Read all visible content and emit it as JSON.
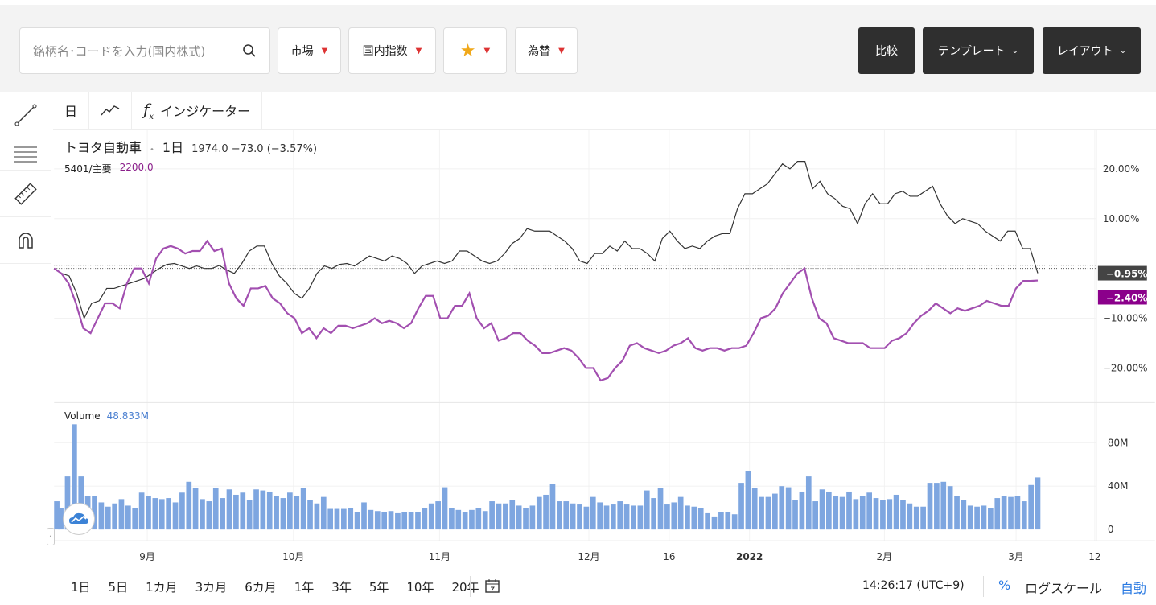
{
  "header": {
    "search_placeholder": "銘柄名･コードを入力(国内株式)",
    "dropdowns": [
      {
        "label": "市場"
      },
      {
        "label": "国内指数"
      },
      {
        "label": "★"
      },
      {
        "label": "為替"
      }
    ],
    "compare_label": "比較",
    "template_label": "テンプレート",
    "layout_label": "レイアウト"
  },
  "chart_toolbar": {
    "interval": "日",
    "indicator_label": "インジケーター"
  },
  "legend": {
    "symbol": "トヨタ自動車",
    "interval": "1日",
    "quote": "1974.0 −73.0 (−3.57%)",
    "compare_symbol": "5401/主要",
    "compare_value": "2200.0"
  },
  "volume_legend": {
    "label": "Volume",
    "value": "48.833M"
  },
  "bottom": {
    "ranges": [
      "1日",
      "5日",
      "1カ月",
      "3カ月",
      "6カ月",
      "1年",
      "3年",
      "5年",
      "10年",
      "20年"
    ],
    "time": "14:26:17 (UTC+9)",
    "percent": "%",
    "log": "ログスケール",
    "auto": "自動"
  },
  "colors": {
    "main_line": "#333333",
    "compare_line": "#a24fb0",
    "volume": "#7ea6e0",
    "main_badge": "#444444",
    "compare_badge": "#8b008b"
  },
  "chart_data": [
    {
      "type": "line",
      "title": "",
      "x_ticks": [
        "9月",
        "10月",
        "11月",
        "12月",
        "16",
        "2022",
        "2月",
        "3月",
        "12"
      ],
      "y_ticks": [
        "20.00%",
        "10.00%",
        "−10.00%",
        "−20.00%"
      ],
      "ylim": [
        -25,
        25
      ],
      "last_labels": {
        "main": "−0.95%",
        "compare": "−2.40%"
      },
      "series": [
        {
          "name": "トヨタ自動車",
          "values": [
            0,
            -1,
            -1.5,
            -5,
            -10,
            -7,
            -6.5,
            -4,
            -4,
            -3.5,
            -3,
            -2.5,
            -2,
            -1,
            0,
            0.8,
            1,
            0.5,
            0,
            0.5,
            0,
            0,
            0.6,
            -0.3,
            -1,
            1,
            3.5,
            4.5,
            4.5,
            1,
            -1.5,
            -3,
            -5,
            -6,
            -4,
            -1,
            0.5,
            0,
            0.8,
            1,
            0.5,
            1.5,
            2.5,
            2,
            1.5,
            2.5,
            2,
            1,
            -1,
            0.5,
            1,
            1.5,
            1,
            1.5,
            3.5,
            3.5,
            2.5,
            1.5,
            1,
            1.5,
            3,
            5,
            6,
            8,
            7.5,
            7.5,
            7.5,
            6.5,
            5.5,
            4,
            1.5,
            1,
            3,
            3,
            4.5,
            3.5,
            5.5,
            4,
            4,
            3,
            1.5,
            6,
            7.5,
            5.5,
            4,
            4.5,
            4,
            5.5,
            6.5,
            7,
            7,
            12,
            15,
            15,
            16,
            17,
            19,
            21,
            20,
            21.5,
            21.5,
            16,
            17.5,
            15,
            14,
            12.5,
            12,
            9,
            13,
            15,
            13,
            13,
            15,
            15.5,
            14.5,
            14.5,
            15.5,
            16.5,
            13,
            10.5,
            9,
            10,
            9.5,
            9,
            7.5,
            6.5,
            5.5,
            7.5,
            7.5,
            4,
            4,
            -0.95
          ]
        },
        {
          "name": "5401/主要",
          "values": [
            0,
            -1,
            -3,
            -7,
            -12,
            -13,
            -10,
            -7,
            -7,
            -8,
            -3,
            0,
            0,
            -3,
            2,
            4,
            4.5,
            4,
            3,
            3.5,
            3.5,
            5.5,
            3.5,
            4,
            -3,
            -6,
            -7.5,
            -4,
            -4,
            -3.5,
            -6,
            -7,
            -9,
            -10,
            -13,
            -12,
            -14,
            -12,
            -13,
            -11.5,
            -11.5,
            -12,
            -11.5,
            -11,
            -10,
            -11,
            -10.5,
            -11,
            -12,
            -11,
            -8,
            -5.5,
            -5.5,
            -10,
            -10,
            -7.5,
            -7.5,
            -5,
            -10,
            -12,
            -11,
            -14.5,
            -14,
            -13,
            -13,
            -14.5,
            -15.5,
            -17,
            -17,
            -16.5,
            -16,
            -16.5,
            -18,
            -20,
            -20,
            -22.5,
            -22,
            -20,
            -18.5,
            -15.5,
            -15,
            -16,
            -16.5,
            -17,
            -16.5,
            -15.5,
            -15,
            -14,
            -16,
            -16.5,
            -16,
            -16,
            -16.5,
            -16,
            -16,
            -15.5,
            -13,
            -10,
            -9.5,
            -8,
            -5,
            -3,
            -1,
            0,
            -6,
            -10,
            -11,
            -14,
            -14.5,
            -15,
            -15,
            -15,
            -16,
            -16,
            -16,
            -14.5,
            -14,
            -13,
            -11,
            -9.5,
            -8.5,
            -7,
            -8,
            -9,
            -8,
            -8.5,
            -8,
            -7.5,
            -6.5,
            -7,
            -7.5,
            -7.5,
            -4,
            -2.5,
            -2.5,
            -2.4
          ]
        }
      ]
    },
    {
      "type": "bar",
      "title": "",
      "y_ticks": [
        "80M",
        "40M",
        "0"
      ],
      "ylim": [
        0,
        100
      ],
      "values": [
        26,
        20,
        49,
        97,
        49,
        31,
        31,
        25,
        21,
        24,
        28,
        22,
        20,
        34,
        31,
        29,
        28,
        29,
        25,
        34,
        44,
        38,
        28,
        26,
        38,
        29,
        37,
        32,
        34,
        27,
        37,
        36,
        35,
        31,
        29,
        34,
        31,
        38,
        27,
        24,
        30,
        19,
        19,
        19,
        20,
        16,
        25,
        18,
        17,
        16,
        17,
        15,
        16,
        16,
        16,
        20,
        24,
        26,
        39,
        20,
        18,
        16,
        18,
        20,
        17,
        26,
        24,
        24,
        27,
        22,
        20,
        22,
        30,
        32,
        42,
        26,
        26,
        24,
        23,
        21,
        30,
        25,
        22,
        23,
        26,
        23,
        22,
        22,
        36,
        29,
        38,
        23,
        25,
        30,
        22,
        21,
        20,
        15,
        12,
        16,
        16,
        14,
        43,
        54,
        38,
        30,
        30,
        33,
        40,
        39,
        27,
        35,
        49,
        26,
        37,
        35,
        31,
        30,
        35,
        28,
        31,
        34,
        29,
        27,
        28,
        32,
        27,
        24,
        21,
        21,
        43,
        43,
        44,
        40,
        31,
        27,
        22,
        21,
        22,
        20,
        29,
        31,
        30,
        31,
        26,
        41,
        48
      ]
    }
  ]
}
